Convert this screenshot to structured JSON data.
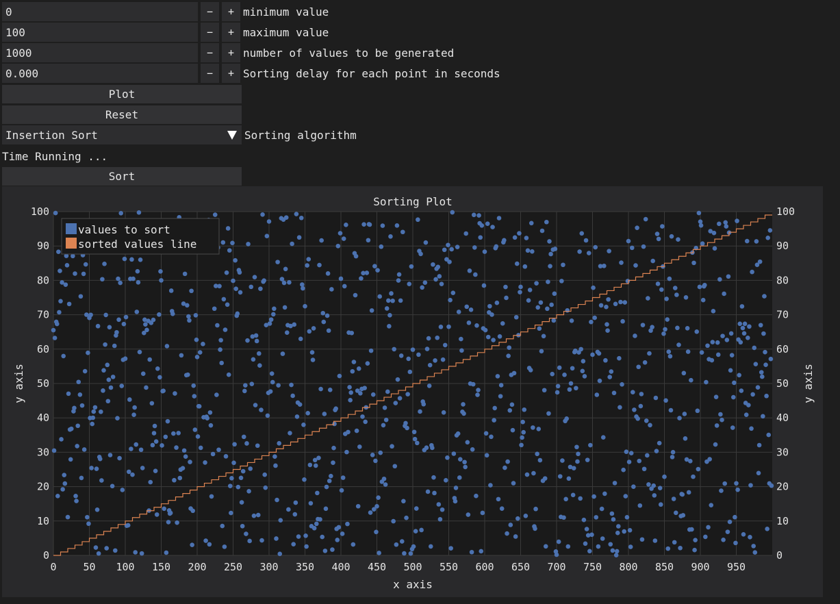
{
  "inputs": [
    {
      "value": "0",
      "minus": "−",
      "plus": "+",
      "label": "minimum value"
    },
    {
      "value": "100",
      "minus": "−",
      "plus": "+",
      "label": "maximum value"
    },
    {
      "value": "1000",
      "minus": "−",
      "plus": "+",
      "label": "number of values to be generated"
    },
    {
      "value": "0.000",
      "minus": "−",
      "plus": "+",
      "label": "Sorting delay for each point in seconds"
    }
  ],
  "buttons": {
    "plot": "Plot",
    "reset": "Reset",
    "sort": "Sort"
  },
  "algorithm": {
    "selected": "Insertion Sort",
    "label": "Sorting algorithm"
  },
  "status": "Time Running ...",
  "colors": {
    "points": "#4c72b0",
    "line": "#dd8452",
    "background": "#1e1e1e",
    "plot_bg": "#1a1a1a"
  },
  "chart_data": {
    "type": "scatter",
    "title": "Sorting Plot",
    "xlabel": "x axis",
    "ylabel": "y axis",
    "y2label": "y axis",
    "xlim": [
      0,
      1000
    ],
    "ylim": [
      0,
      100
    ],
    "xticks": [
      "0",
      "50",
      "100",
      "150",
      "200",
      "250",
      "300",
      "350",
      "400",
      "450",
      "500",
      "550",
      "600",
      "650",
      "700",
      "750",
      "800",
      "850",
      "900",
      "950"
    ],
    "yticks": [
      "0",
      "10",
      "20",
      "30",
      "40",
      "50",
      "60",
      "70",
      "80",
      "90",
      "100"
    ],
    "legend": {
      "position": "top-left",
      "entries": [
        "values to sort",
        "sorted values line"
      ]
    },
    "grid": true,
    "series": [
      {
        "name": "values to sort",
        "kind": "scatter",
        "n": 1000,
        "min": 0,
        "max": 100
      },
      {
        "name": "sorted values line",
        "kind": "step-line",
        "x": [
          0,
          1000
        ],
        "y": [
          0,
          100
        ]
      }
    ]
  }
}
